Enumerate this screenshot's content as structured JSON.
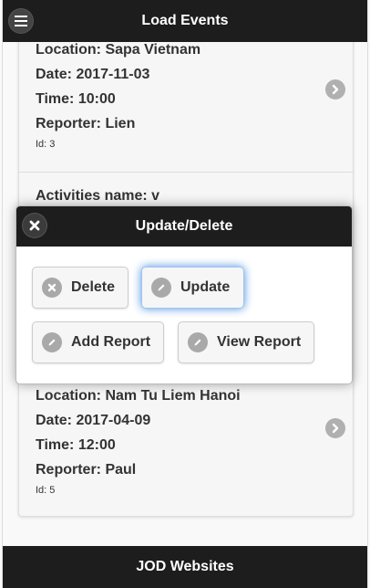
{
  "header": {
    "title": "Load Events"
  },
  "items": [
    {
      "location": "Location: Sapa Vietnam",
      "date": "Date: 2017-11-03",
      "time": "Time: 10:00",
      "reporter": "Reporter: Lien",
      "id": "Id: 3"
    },
    {
      "activity": "Activities name: v"
    },
    {
      "location": "Location: Nam Tu Liem Hanoi",
      "date": "Date: 2017-04-09",
      "time": "Time: 12:00",
      "reporter": "Reporter: Paul",
      "id": "Id: 5"
    }
  ],
  "popup": {
    "title": "Update/Delete",
    "delete_label": "Delete",
    "update_label": "Update",
    "add_report_label": "Add Report",
    "view_report_label": "View Report"
  },
  "footer": {
    "title": "JOD Websites"
  },
  "icons": {
    "menu": "menu-icon",
    "chevron": "chevron-right-icon",
    "close": "close-icon",
    "delete": "delete-icon",
    "edit": "edit-icon"
  }
}
